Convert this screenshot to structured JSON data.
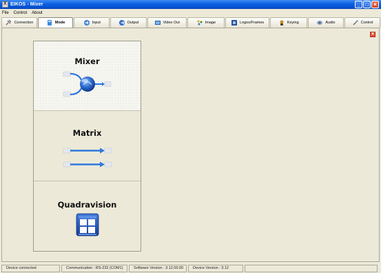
{
  "window": {
    "title": "EIKOS - Mixer"
  },
  "menu": [
    "File",
    "Control",
    "About"
  ],
  "tabs": [
    {
      "label": "Connection",
      "icon": "plug-icon"
    },
    {
      "label": "Mode",
      "icon": "mode-icon",
      "active": true
    },
    {
      "label": "Input",
      "icon": "input-icon"
    },
    {
      "label": "Output",
      "icon": "output-icon"
    },
    {
      "label": "Video Out",
      "icon": "video-out-icon"
    },
    {
      "label": "Image",
      "icon": "image-icon"
    },
    {
      "label": "Logos/Frames",
      "icon": "logos-frames-icon"
    },
    {
      "label": "Keying",
      "icon": "keying-icon"
    },
    {
      "label": "Audio",
      "icon": "audio-icon"
    },
    {
      "label": "Control",
      "icon": "control-icon"
    }
  ],
  "modes": [
    {
      "label": "Mixer",
      "selected": true
    },
    {
      "label": "Matrix",
      "selected": false
    },
    {
      "label": "Quadravision",
      "selected": false
    }
  ],
  "status": {
    "device": "Device connected",
    "communication": "Communication : RS-232 (COM1)",
    "software_version": "Software Version : 3.12.00.00",
    "device_version": "Device Version : 3.12"
  },
  "colors": {
    "titlebar": "#0a5fe0",
    "accent_blue": "#2a6fd8",
    "close_red": "#d8502f"
  }
}
